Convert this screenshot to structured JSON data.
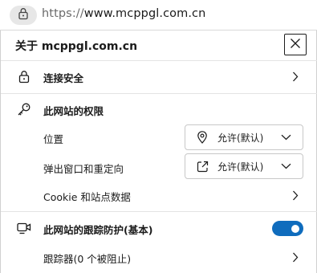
{
  "address_bar": {
    "url_protocol": "https://",
    "url_host": "www.mcppgl.com.cn"
  },
  "popup": {
    "title": "关于 mcppgl.com.cn",
    "connection": {
      "label": "连接安全"
    },
    "permissions": {
      "heading": "此网站的权限",
      "location": {
        "label": "位置",
        "value": "允许(默认)"
      },
      "popups": {
        "label": "弹出窗口和重定向",
        "value": "允许(默认)"
      },
      "cookies": {
        "label": "Cookie 和站点数据"
      }
    },
    "tracking": {
      "heading": "此网站的跟踪防护(基本)",
      "toggle_on": true,
      "trackers": {
        "label": "跟踪器(0 个被阻止)"
      }
    }
  },
  "colors": {
    "accent": "#0f6cbd",
    "text": "#1b1b1b",
    "divider": "#e4e4e4"
  }
}
